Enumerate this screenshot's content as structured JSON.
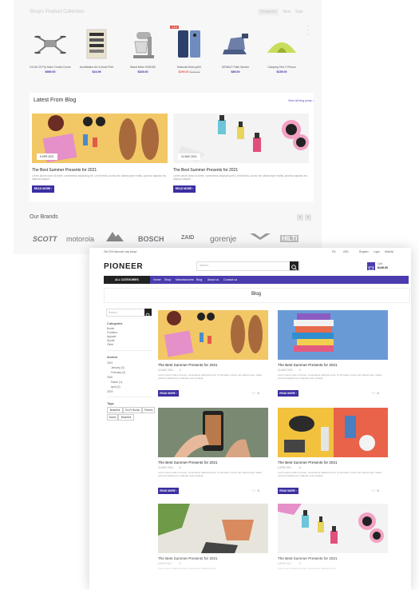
{
  "back": {
    "section_title": "Shop's Product Collection",
    "top_nav": [
      "Featured",
      "New",
      "Sale"
    ],
    "products": [
      {
        "name": "DJI Air 2S Fly More Combo Drone",
        "price": "$989.00",
        "icon": "drone-icon"
      },
      {
        "name": "Annihilation Art & Book Print",
        "price": "$24.99",
        "icon": "art-print-icon"
      },
      {
        "name": "Stand Mixer KSM150",
        "price": "$345.00",
        "icon": "mixer-icon"
      },
      {
        "name": "Motorola Moto g100",
        "price": "$299.00",
        "old_price": "$349.00",
        "sale": true,
        "icon": "phone-icon"
      },
      {
        "name": "DEWALT Palm Sander",
        "price": "$89.00",
        "icon": "sander-icon"
      },
      {
        "name": "Camping Tent 2 Person",
        "price": "$159.00",
        "icon": "tent-icon"
      }
    ],
    "blog": {
      "title": "Latest From Blog",
      "view_all": "View all blog posts  ›",
      "posts": [
        {
          "date": "5 APR 2021",
          "title": "The Best Summer Presents for 2021",
          "excerpt": "Lorem ipsum dolor sit amet, consectetur adipiscing elit. Ut elit tellus, luctus nec ullamcorper mattis, pulvinar dapibus leo. Aliquam aliquet.",
          "read_more": "READ MORE  ›"
        },
        {
          "date": "24 MAY 2021",
          "title": "The Best Summer Presents for 2021",
          "excerpt": "Lorem ipsum dolor sit amet, consectetur adipiscing elit. Ut elit tellus, luctus nec ullamcorper mattis, pulvinar dapibus leo. Aliquam aliquet.",
          "read_more": "READ MORE  ›"
        }
      ]
    },
    "brands": {
      "title": "Our Brands",
      "items": [
        "SCOTT",
        "motorola",
        "",
        "BOSCH",
        "ZAID",
        "gorenje",
        "",
        "HILTI"
      ]
    }
  },
  "front": {
    "top_notice": "Get 20% discount only today!",
    "top_right": [
      "EN",
      "USD",
      "Register",
      "Login",
      "Wishlist"
    ],
    "logo": "PIONEER",
    "search_placeholder": "Search...",
    "cart": {
      "label": "Cart",
      "amount": "$149.00"
    },
    "all_categories": "ALL CATEGORIES",
    "nav": [
      "Home",
      "Shop",
      "Manufacturers",
      "Blog",
      "About us",
      "Contact us"
    ],
    "page_title": "Blog",
    "sidebar": {
      "search_placeholder": "Search",
      "categories_title": "Categories",
      "categories": [
        "Books",
        "Furniture",
        "Apparel",
        "Sports",
        "Other"
      ],
      "archive_title": "Archive",
      "archive": [
        "2021",
        "January (3)",
        "February (2)",
        "2020",
        "March (1)",
        "April (2)",
        "2019"
      ],
      "tags_title": "Tags",
      "tags": [
        "Beautiful",
        "Sci-Fi Books",
        "Phones",
        "Books",
        "Beautiful"
      ]
    },
    "posts": [
      {
        "title": "The Best Summer Presents for 2021",
        "date": "24 MAY 2021",
        "comments": "3",
        "excerpt": "Lorem ipsum dolor sit amet, consectetur adipiscing elit. Ut elit tellus, luctus nec ullamcorper mattis, pulvinar dapibus leo. Aliquam erat volutpat.",
        "read_more": "READ MORE  ›"
      },
      {
        "title": "The Best Summer Presents for 2021",
        "date": "24 MAY 2021",
        "comments": "3",
        "excerpt": "Lorem ipsum dolor sit amet, consectetur adipiscing elit. Ut elit tellus, luctus nec ullamcorper mattis, pulvinar dapibus leo. Aliquam erat volutpat.",
        "read_more": "READ MORE  ›"
      },
      {
        "title": "The Best Summer Presents for 2021",
        "date": "24 MAY 2021",
        "comments": "0",
        "excerpt": "Lorem ipsum dolor sit amet, consectetur adipiscing elit. Ut elit tellus, luctus nec ullamcorper mattis, pulvinar dapibus leo. Aliquam erat volutpat.",
        "read_more": "READ MORE  ›"
      },
      {
        "title": "The Best Summer Presents for 2021",
        "date": "5 APR 2021",
        "comments": "0",
        "excerpt": "Lorem ipsum dolor sit amet, consectetur adipiscing elit. Ut elit tellus, luctus nec ullamcorper mattis, pulvinar dapibus leo. Aliquam erat volutpat.",
        "read_more": "READ MORE  ›"
      },
      {
        "title": "The Best Summer Presents for 2021",
        "date": "5 APR 2021",
        "comments": "0",
        "excerpt": "Lorem ipsum dolor sit amet, consectetur adipiscing elit.",
        "read_more": ""
      },
      {
        "title": "The Best Summer Presents for 2021",
        "date": "5 APR 2021",
        "comments": "0",
        "excerpt": "Lorem ipsum dolor sit amet, consectetur adipiscing elit.",
        "read_more": ""
      }
    ],
    "colors": {
      "accent": "#4a3cad",
      "dark": "#222222"
    }
  }
}
